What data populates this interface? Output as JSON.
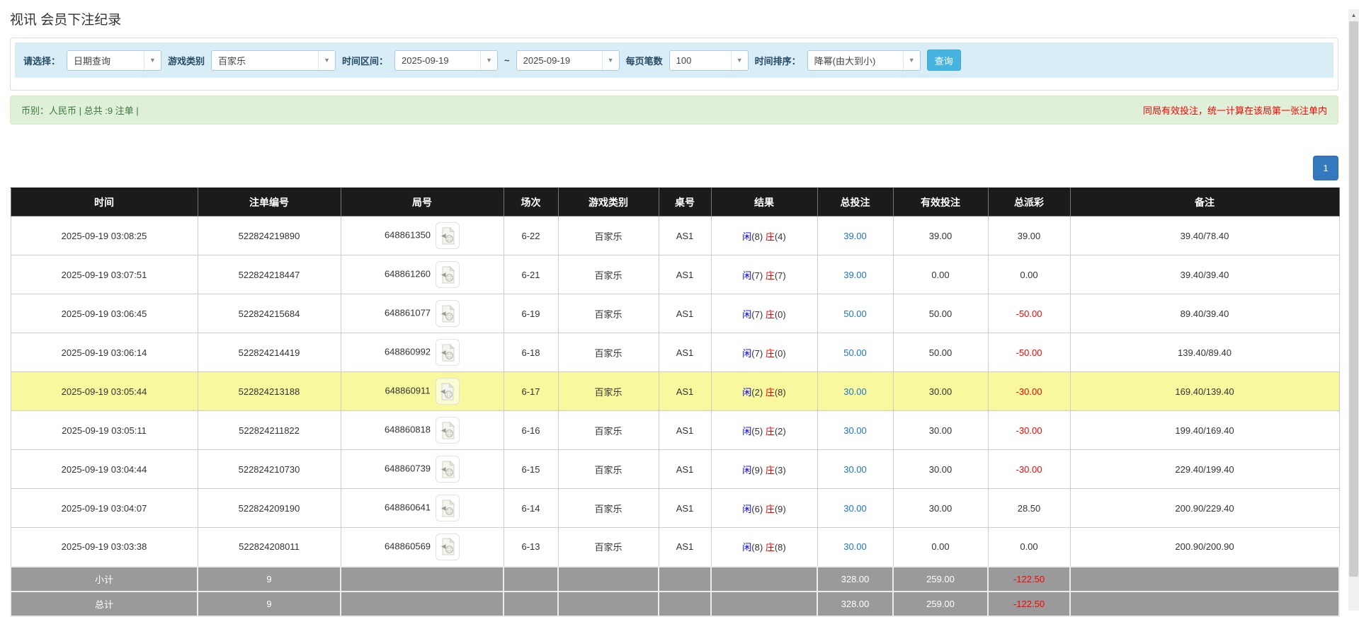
{
  "page": {
    "title": "视讯 会员下注纪录"
  },
  "filters": {
    "select_label": "请选择：",
    "select_value": "日期查询",
    "game_label": "游戏类别",
    "game_value": "百家乐",
    "range_label": "时间区间：",
    "date_from": "2025-09-19",
    "range_separator": "~",
    "date_to": "2025-09-19",
    "page_size_label": "每页笔数",
    "page_size_value": "100",
    "sort_label": "时间排序：",
    "sort_value": "降幂(由大到小)",
    "search_button": "查询",
    "dropdown_arrow": "▼"
  },
  "summary": {
    "left_text": "币别：人民币 | 总共 :9 注单 |",
    "right_notice": "同局有效投注，统一计算在该局第一张注单内"
  },
  "pagination": {
    "current_page": "1"
  },
  "scrollbar": {
    "up_arrow": "▲"
  },
  "colors": {
    "accent_blue": "#45b4e0",
    "link_blue": "#1a73d1",
    "player_blue": "#0000ee",
    "banker_red": "#e60000",
    "negative_red": "#ff0000",
    "highlight_yellow": "#f8f89e",
    "pager_blue": "#3478be"
  },
  "table": {
    "columns": [
      "时间",
      "注单编号",
      "局号",
      "场次",
      "游戏类别",
      "桌号",
      "结果",
      "总投注",
      "有效投注",
      "总派彩",
      "备注"
    ],
    "rows": [
      {
        "time": "2025-09-19 03:08:25",
        "bet_id": "522824219890",
        "round_id": "648861350",
        "session": "6-22",
        "game": "百家乐",
        "table_no": "AS1",
        "player": "闲",
        "player_score": "(8)",
        "banker": "庄",
        "banker_score": "(4)",
        "total_bet": "39.00",
        "valid_bet": "39.00",
        "payout": "39.00",
        "remark": "39.40/78.40",
        "highlight": false
      },
      {
        "time": "2025-09-19 03:07:51",
        "bet_id": "522824218447",
        "round_id": "648861260",
        "session": "6-21",
        "game": "百家乐",
        "table_no": "AS1",
        "player": "闲",
        "player_score": "(7)",
        "banker": "庄",
        "banker_score": "(7)",
        "total_bet": "39.00",
        "valid_bet": "0.00",
        "payout": "0.00",
        "remark": "39.40/39.40",
        "highlight": false
      },
      {
        "time": "2025-09-19 03:06:45",
        "bet_id": "522824215684",
        "round_id": "648861077",
        "session": "6-19",
        "game": "百家乐",
        "table_no": "AS1",
        "player": "闲",
        "player_score": "(7)",
        "banker": "庄",
        "banker_score": "(0)",
        "total_bet": "50.00",
        "valid_bet": "50.00",
        "payout": "-50.00",
        "remark": "89.40/39.40",
        "highlight": false
      },
      {
        "time": "2025-09-19 03:06:14",
        "bet_id": "522824214419",
        "round_id": "648860992",
        "session": "6-18",
        "game": "百家乐",
        "table_no": "AS1",
        "player": "闲",
        "player_score": "(7)",
        "banker": "庄",
        "banker_score": "(0)",
        "total_bet": "50.00",
        "valid_bet": "50.00",
        "payout": "-50.00",
        "remark": "139.40/89.40",
        "highlight": false
      },
      {
        "time": "2025-09-19 03:05:44",
        "bet_id": "522824213188",
        "round_id": "648860911",
        "session": "6-17",
        "game": "百家乐",
        "table_no": "AS1",
        "player": "闲",
        "player_score": "(2)",
        "banker": "庄",
        "banker_score": "(8)",
        "total_bet": "30.00",
        "valid_bet": "30.00",
        "payout": "-30.00",
        "remark": "169.40/139.40",
        "highlight": true
      },
      {
        "time": "2025-09-19 03:05:11",
        "bet_id": "522824211822",
        "round_id": "648860818",
        "session": "6-16",
        "game": "百家乐",
        "table_no": "AS1",
        "player": "闲",
        "player_score": "(5)",
        "banker": "庄",
        "banker_score": "(2)",
        "total_bet": "30.00",
        "valid_bet": "30.00",
        "payout": "-30.00",
        "remark": "199.40/169.40",
        "highlight": false
      },
      {
        "time": "2025-09-19 03:04:44",
        "bet_id": "522824210730",
        "round_id": "648860739",
        "session": "6-15",
        "game": "百家乐",
        "table_no": "AS1",
        "player": "闲",
        "player_score": "(9)",
        "banker": "庄",
        "banker_score": "(3)",
        "total_bet": "30.00",
        "valid_bet": "30.00",
        "payout": "-30.00",
        "remark": "229.40/199.40",
        "highlight": false
      },
      {
        "time": "2025-09-19 03:04:07",
        "bet_id": "522824209190",
        "round_id": "648860641",
        "session": "6-14",
        "game": "百家乐",
        "table_no": "AS1",
        "player": "闲",
        "player_score": "(6)",
        "banker": "庄",
        "banker_score": "(9)",
        "total_bet": "30.00",
        "valid_bet": "30.00",
        "payout": "28.50",
        "remark": "200.90/229.40",
        "highlight": false
      },
      {
        "time": "2025-09-19 03:03:38",
        "bet_id": "522824208011",
        "round_id": "648860569",
        "session": "6-13",
        "game": "百家乐",
        "table_no": "AS1",
        "player": "闲",
        "player_score": "(8)",
        "banker": "庄",
        "banker_score": "(8)",
        "total_bet": "30.00",
        "valid_bet": "0.00",
        "payout": "0.00",
        "remark": "200.90/200.90",
        "highlight": false
      }
    ],
    "footer": [
      {
        "label": "小计",
        "count": "9",
        "total_bet": "328.00",
        "valid_bet": "259.00",
        "payout": "-122.50"
      },
      {
        "label": "总计",
        "count": "9",
        "total_bet": "328.00",
        "valid_bet": "259.00",
        "payout": "-122.50"
      }
    ]
  }
}
